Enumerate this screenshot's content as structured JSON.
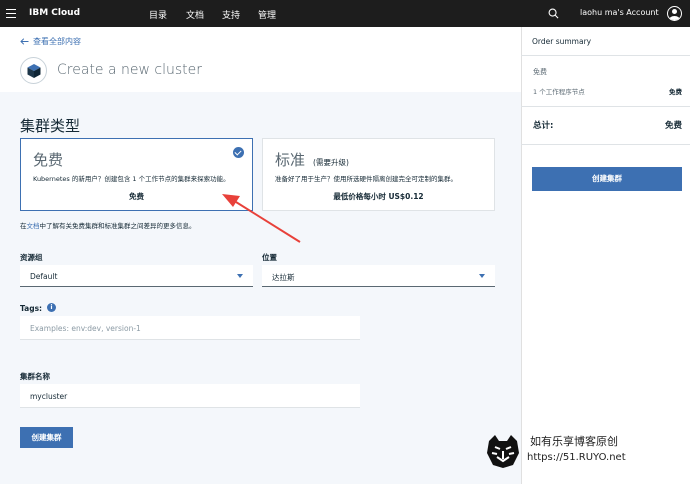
{
  "topbar": {
    "brand": "IBM Cloud",
    "nav": [
      "目录",
      "文档",
      "支持",
      "管理"
    ],
    "account": "laohu ma's Account"
  },
  "header": {
    "back_link": "查看全部内容",
    "title": "Create a new cluster"
  },
  "cluster_type": {
    "title": "集群类型",
    "free": {
      "heading": "免费",
      "description": "Kubernetes 的新用户？创建包含 1 个工作节点的集群来探索功能。",
      "footer": "免费",
      "selected": true
    },
    "standard": {
      "heading": "标准",
      "subheading": "(需要升级)",
      "description": "准备好了用于生产？使用所选硬件隔离创建完全可定制的集群。",
      "footer": "最低价格每小时 US$0.12"
    },
    "info_prefix": "在",
    "info_link": "文档",
    "info_suffix": "中了解有关免费集群和标准集群之间差异的更多信息。"
  },
  "form": {
    "resource_group_label": "资源组",
    "resource_group_value": "Default",
    "location_label": "位置",
    "location_value": "达拉斯",
    "tags_label": "Tags:",
    "tags_placeholder": "Examples: env:dev, version-1",
    "cluster_name_label": "集群名称",
    "cluster_name_value": "mycluster",
    "create_button": "创建集群"
  },
  "summary": {
    "title": "Order summary",
    "plan": "免费",
    "worker_label": "1 个工作程序节点",
    "worker_value": "免费",
    "total_label": "总计:",
    "total_value": "免费",
    "create_button": "创建集群"
  },
  "watermark": {
    "line1": "如有乐享博客原创",
    "line2": "https://51.RUYO.net"
  },
  "colors": {
    "accent": "#3d70b2",
    "topbar": "#1d1d1d",
    "annotation_arrow": "#e8413a"
  }
}
